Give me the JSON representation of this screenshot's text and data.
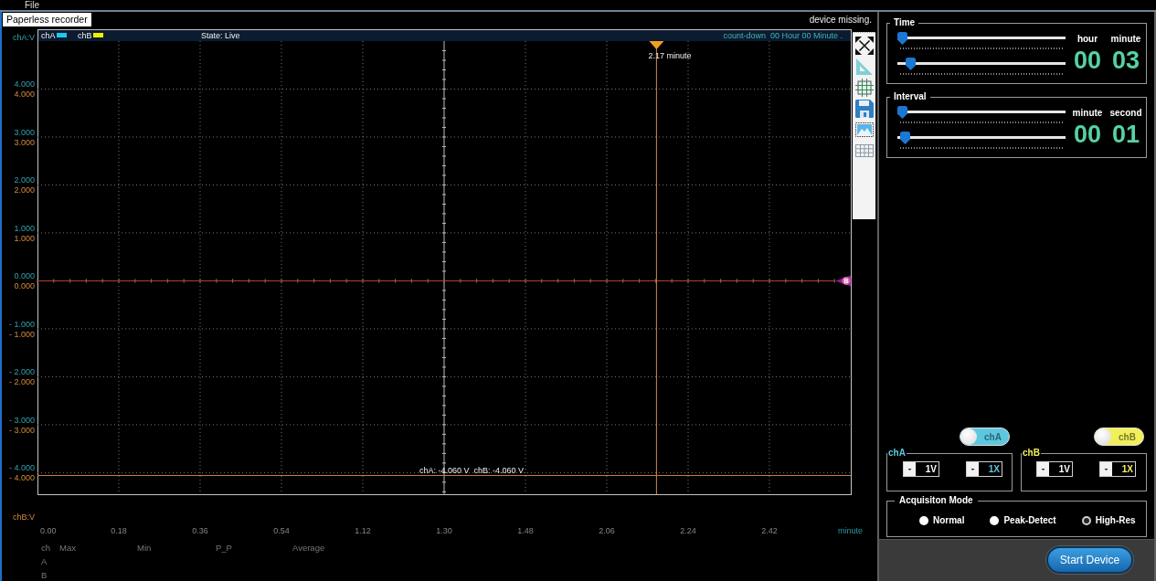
{
  "menu": [
    "File"
  ],
  "tab": {
    "label": "Paperless recorder",
    "selected": true
  },
  "status": "device missing.",
  "chart": {
    "header": {
      "legend": [
        {
          "label": "chA",
          "color": "#1ec8f0"
        },
        {
          "label": "chB",
          "color": "#f0f000"
        }
      ],
      "state": "State: Live",
      "countdown": "count-down  00 Hour 00 Minute ."
    },
    "y_axis_a": {
      "title": "chA:V",
      "ticks": [
        "4.000",
        "3.000",
        "2.000",
        "1.000",
        "0.000",
        "- 1.000",
        "- 2.000",
        "- 3.000",
        "- 4.000"
      ]
    },
    "y_axis_b": {
      "title": "chB:V",
      "ticks": [
        "4.000",
        "3.000",
        "2.000",
        "1.000",
        "0.000",
        "- 1.000",
        "- 2.000",
        "- 3.000",
        "- 4.000"
      ]
    },
    "x_axis": {
      "title": "minute",
      "ticks": [
        "0.00",
        "0.18",
        "0.36",
        "0.54",
        "1.12",
        "1.30",
        "1.48",
        "2.06",
        "2.24",
        "2.42"
      ]
    },
    "cursors": [
      {
        "kind": "vertical",
        "label": "2.17 minute"
      },
      {
        "kind": "horizontal",
        "label": "chA: -4.060 V  chB: -4.060 V"
      }
    ],
    "marker": {
      "label": "B"
    }
  },
  "stats": {
    "columns": [
      "ch",
      "Max",
      "Min",
      "P_P",
      "Average"
    ],
    "rows": [
      [
        "A"
      ],
      [
        "B"
      ]
    ]
  },
  "time": {
    "title": "Time",
    "sliders": [
      {
        "level": 0
      },
      {
        "level": 0.05
      }
    ],
    "fields": [
      {
        "label": "hour",
        "value": "00"
      },
      {
        "label": "minute",
        "value": "03"
      }
    ]
  },
  "interval": {
    "title": "Interval",
    "sliders": [
      {
        "level": 0
      },
      {
        "level": 0.02
      }
    ],
    "fields": [
      {
        "label": "minute",
        "value": "00"
      },
      {
        "label": "second",
        "value": "01"
      }
    ]
  },
  "channels": [
    {
      "toggle": {
        "label": "chA",
        "on": false
      },
      "title": "chA",
      "color": "#5cc8e0",
      "selects": [
        {
          "kind": "voltage",
          "value": "1V"
        },
        {
          "kind": "probe",
          "value": "1X"
        }
      ]
    },
    {
      "toggle": {
        "label": "chB",
        "on": false
      },
      "title": "chB",
      "color": "#f2f05a",
      "selects": [
        {
          "kind": "voltage",
          "value": "1V"
        },
        {
          "kind": "probe",
          "value": "1X"
        }
      ]
    }
  ],
  "acquisition": {
    "title": "Acquisiton Mode",
    "options": [
      {
        "label": "Normal",
        "selected": false
      },
      {
        "label": "Peak-Detect",
        "selected": false
      },
      {
        "label": "High-Res",
        "selected": true
      }
    ]
  },
  "start_button": "Start Device"
}
